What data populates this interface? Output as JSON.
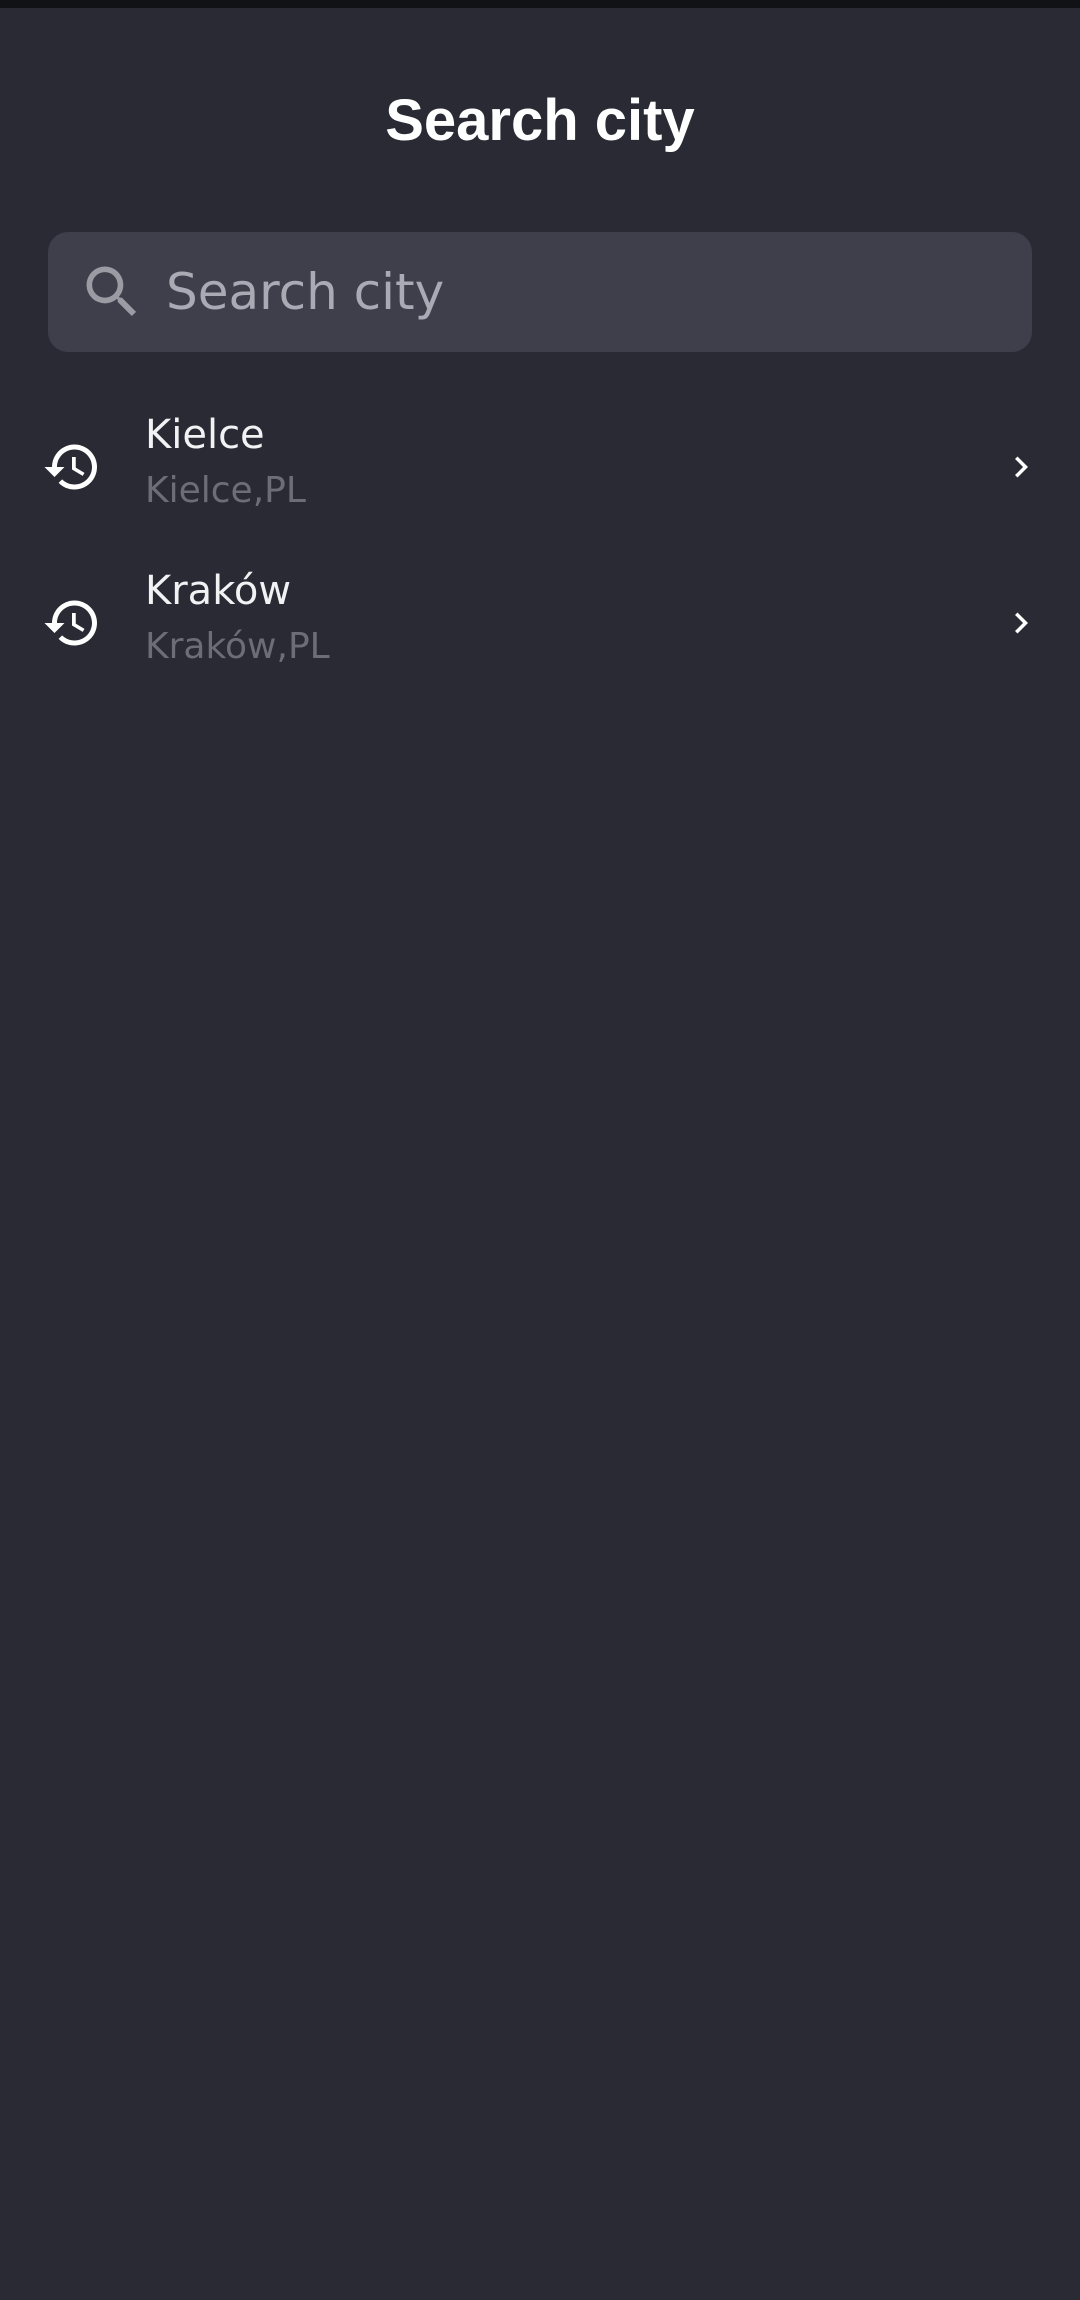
{
  "header": {
    "title": "Search city"
  },
  "search": {
    "placeholder": "Search city",
    "value": "",
    "icon": "search-icon"
  },
  "recent_cities": [
    {
      "name": "Kielce",
      "subtitle": "Kielce,PL",
      "icon": "history-icon",
      "action_icon": "chevron-right-icon"
    },
    {
      "name": "Kraków",
      "subtitle": "Kraków,PL",
      "icon": "history-icon",
      "action_icon": "chevron-right-icon"
    }
  ],
  "colors": {
    "background": "#292a33",
    "search_field": "#3e3f4a",
    "primary_text": "#ffffff",
    "secondary_text": "#6c6d76",
    "placeholder": "#a9aab3"
  }
}
